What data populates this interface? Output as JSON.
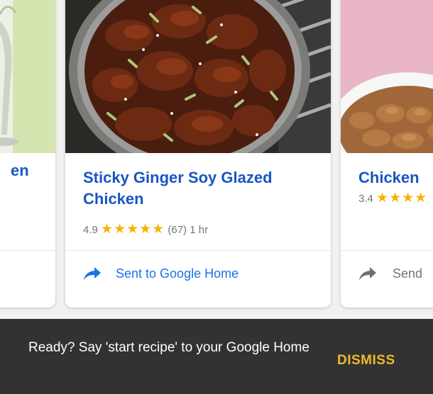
{
  "cards": [
    {
      "title": "en"
    },
    {
      "title": "Sticky Ginger Soy Glazed Chicken",
      "rating": "4.9",
      "stars": "★★★★★",
      "reviews": "(67)",
      "time": "1 hr",
      "action_label": "Sent to Google Home",
      "action_icon": "share-arrow-icon"
    },
    {
      "title": "Chicken",
      "rating": "3.4",
      "stars": "★★★★",
      "action_label": "Send",
      "action_icon": "share-arrow-icon"
    }
  ],
  "snackbar": {
    "message": "Ready? Say 'start recipe' to your Google Home",
    "dismiss_label": "DISMISS"
  },
  "colors": {
    "title_link": "#1a55c4",
    "action_blue": "#1a73e8",
    "star": "#f4b400",
    "snackbar_bg": "#323232",
    "dismiss": "#f2b92b"
  }
}
